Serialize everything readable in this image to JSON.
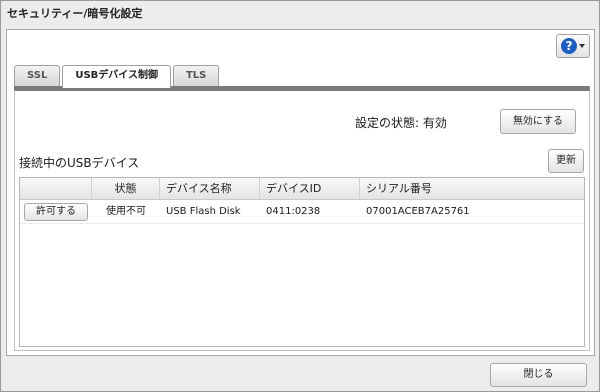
{
  "window": {
    "title": "セキュリティー/暗号化設定"
  },
  "help": {
    "glyph": "?",
    "icon": "help-icon"
  },
  "tabs": [
    {
      "label": "SSL",
      "active": false
    },
    {
      "label": "USBデバイス制御",
      "active": true
    },
    {
      "label": "TLS",
      "active": false
    }
  ],
  "status": {
    "text": "設定の状態: 有効",
    "disable_label": "無効にする"
  },
  "devices": {
    "title": "接続中のUSBデバイス",
    "refresh_label": "更新",
    "columns": [
      "",
      "状態",
      "デバイス名称",
      "デバイスID",
      "シリアル番号"
    ],
    "rows": [
      {
        "action": "許可する",
        "status": "使用不可",
        "name": "USB Flash Disk",
        "id": "0411:0238",
        "serial": "07001ACEB7A25761"
      }
    ]
  },
  "footer": {
    "close_label": "閉じる"
  },
  "colors": {
    "help_blue": "#1f5fbf",
    "panel_bg": "#ececec"
  }
}
